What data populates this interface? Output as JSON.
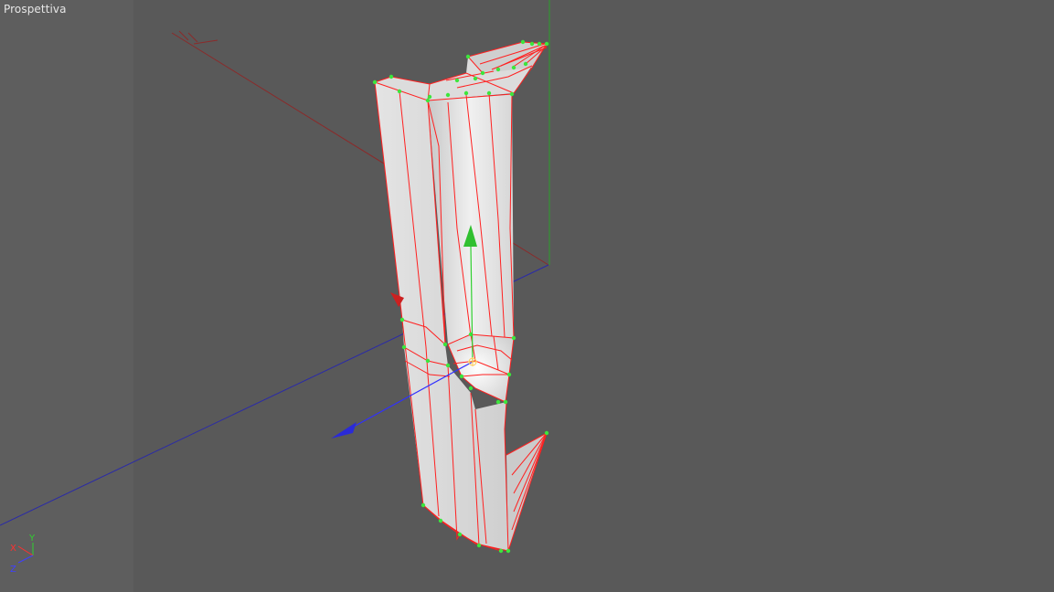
{
  "viewport": {
    "title": "Prospettiva"
  },
  "axis_indicator": {
    "x_label": "X",
    "y_label": "Y",
    "z_label": "Z"
  },
  "colors": {
    "background": "#595959",
    "left_band": "#5e5e5e",
    "mesh_face": "#d9d9d9",
    "mesh_edge": "#ff2020",
    "vertex": "#3ce63c",
    "axis_x": "#ff3030",
    "axis_y": "#30d030",
    "axis_z": "#3030ff",
    "world_x_line": "#8b2a2a",
    "world_y_line": "#2aa02a",
    "world_z_line": "#2a2aa8"
  },
  "icons": [
    "move-gizmo-icon",
    "axis-indicator-icon"
  ]
}
